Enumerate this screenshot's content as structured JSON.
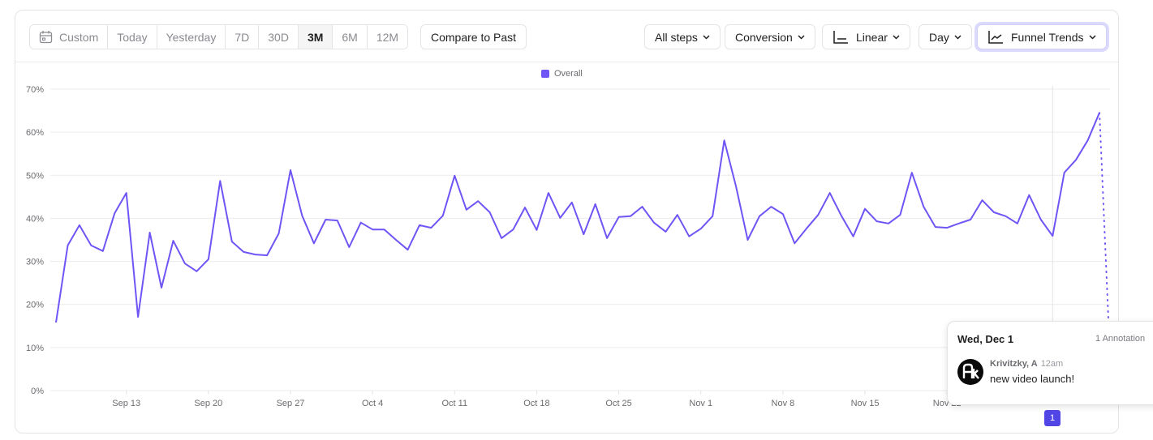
{
  "toolbar": {
    "date_ranges": [
      {
        "label": "Custom",
        "icon": "calendar-icon",
        "active": false
      },
      {
        "label": "Today",
        "active": false
      },
      {
        "label": "Yesterday",
        "active": false
      },
      {
        "label": "7D",
        "active": false
      },
      {
        "label": "30D",
        "active": false
      },
      {
        "label": "3M",
        "active": true
      },
      {
        "label": "6M",
        "active": false
      },
      {
        "label": "12M",
        "active": false
      }
    ],
    "compare_label": "Compare to Past",
    "steps_label": "All steps",
    "metric_label": "Conversion",
    "scale_label": "Linear",
    "scale_icon": "axis-icon",
    "interval_label": "Day",
    "chart_type_label": "Funnel Trends",
    "chart_type_icon": "line-chart-icon"
  },
  "colors": {
    "series": "#6f55f5",
    "annotation": "#5145e6"
  },
  "annotation": {
    "date": "Wed, Dec 1",
    "count_label": "1 Annotation",
    "author": "Krivitzky, A",
    "time": "12am",
    "text": "new video launch!",
    "marker_label": "1"
  },
  "chart_data": {
    "type": "line",
    "title": "",
    "xlabel": "",
    "ylabel": "",
    "ylim": [
      0,
      70
    ],
    "y_ticks": [
      "0%",
      "10%",
      "20%",
      "30%",
      "40%",
      "50%",
      "60%",
      "70%"
    ],
    "y_tick_values": [
      0,
      10,
      20,
      30,
      40,
      50,
      60,
      70
    ],
    "x_ticks": [
      "Sep 13",
      "Sep 20",
      "Sep 27",
      "Oct 4",
      "Oct 11",
      "Oct 18",
      "Oct 25",
      "Nov 1",
      "Nov 8",
      "Nov 15",
      "Nov 22"
    ],
    "x_tick_day_index": [
      6,
      13,
      20,
      27,
      34,
      41,
      48,
      55,
      62,
      69,
      76
    ],
    "x_start": "Sep 7",
    "x_end": "Dec 5",
    "grid": true,
    "legend": "top-center",
    "annotation_day_index": 85,
    "series": [
      {
        "name": "Overall",
        "values": [
          15.8,
          33.7,
          38.4,
          33.7,
          32.4,
          41.2,
          45.9,
          17.1,
          36.7,
          23.9,
          34.8,
          29.5,
          27.7,
          30.5,
          48.7,
          34.6,
          32.2,
          31.6,
          31.4,
          36.5,
          51.2,
          40.6,
          34.2,
          39.7,
          39.5,
          33.3,
          39.0,
          37.4,
          37.4,
          35.0,
          32.7,
          38.4,
          37.8,
          40.6,
          49.9,
          42.0,
          44.0,
          41.4,
          35.4,
          37.4,
          42.5,
          37.3,
          45.9,
          40.1,
          43.7,
          36.3,
          43.3,
          35.4,
          40.3,
          40.5,
          42.7,
          39.0,
          36.9,
          40.8,
          35.8,
          37.6,
          40.5,
          58.1,
          47.4,
          35.0,
          40.5,
          42.7,
          41.0,
          34.2,
          37.6,
          40.8,
          45.9,
          40.5,
          35.8,
          42.2,
          39.3,
          38.8,
          40.8,
          50.6,
          42.7,
          38.0,
          37.8,
          38.8,
          39.7,
          44.2,
          41.4,
          40.5,
          38.8,
          45.4,
          39.7,
          35.9,
          50.6,
          53.6,
          58.1,
          64.5
        ],
        "partial_period_value": 16.4
      }
    ]
  }
}
